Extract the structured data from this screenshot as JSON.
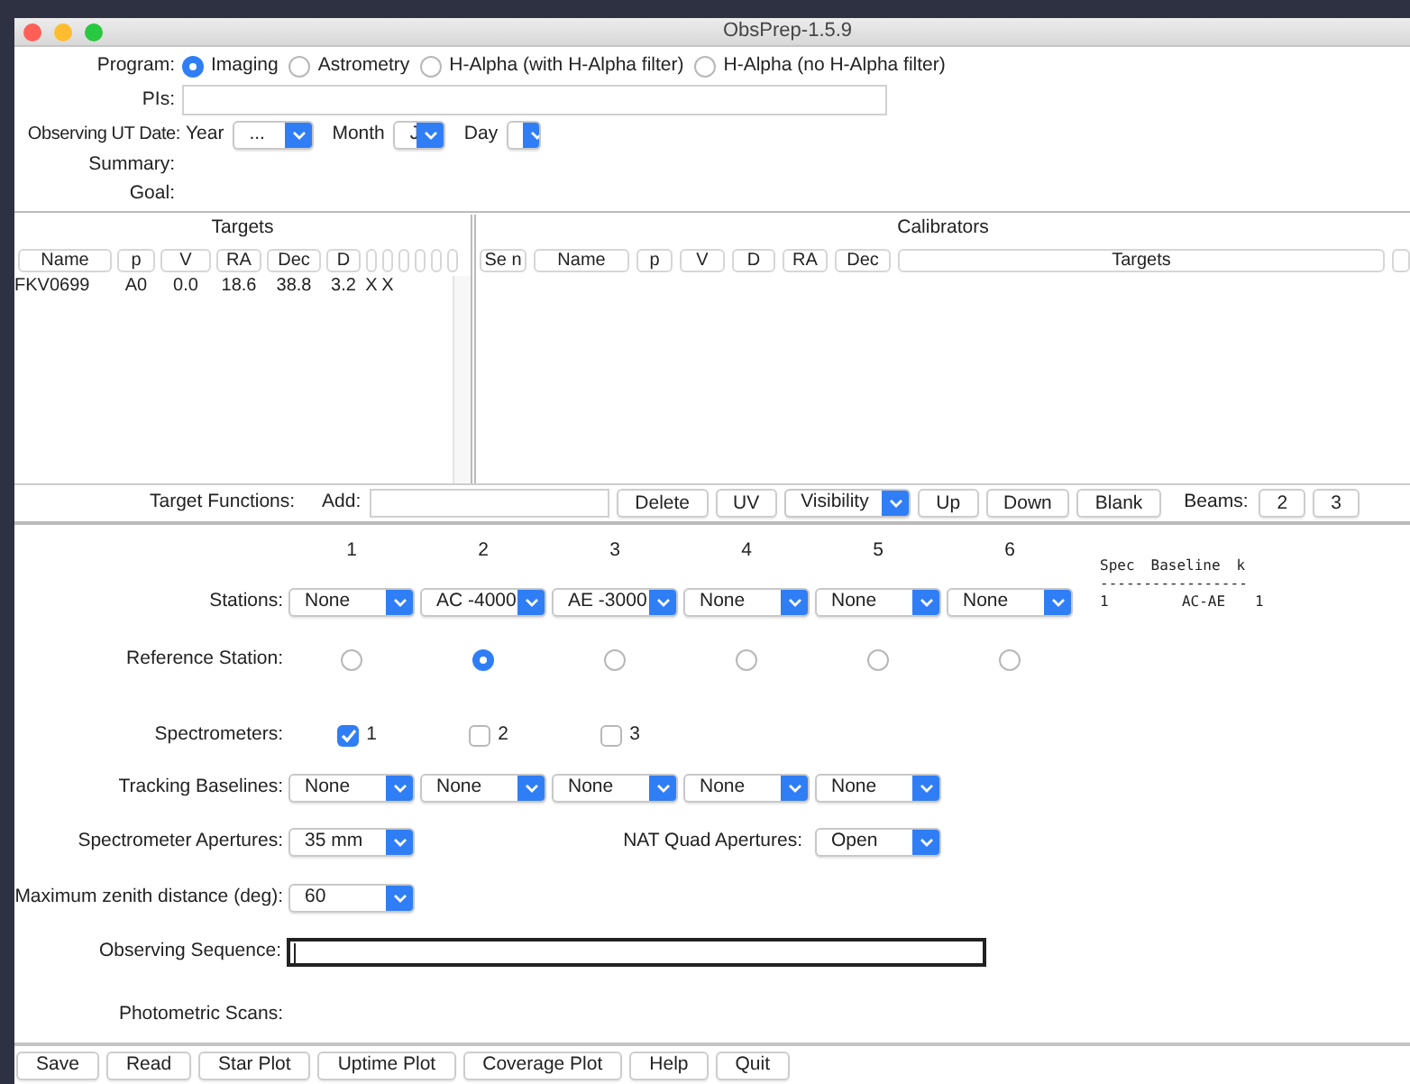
{
  "window": {
    "title": "ObsPrep-1.5.9"
  },
  "program": {
    "label": "Program:",
    "options": [
      {
        "label": "Imaging",
        "selected": true
      },
      {
        "label": "Astrometry",
        "selected": false
      },
      {
        "label": "H-Alpha (with H-Alpha filter)",
        "selected": false
      },
      {
        "label": "H-Alpha (no H-Alpha filter)",
        "selected": false
      }
    ]
  },
  "pis": {
    "label": "PIs:"
  },
  "date": {
    "label": "Observing UT Date:",
    "fields": [
      {
        "label": "Year",
        "value": "..."
      },
      {
        "label": "Month",
        "value": "J"
      },
      {
        "label": "Day"
      }
    ]
  },
  "summary": {
    "label": "Summary:"
  },
  "goal": {
    "label": "Goal:"
  },
  "targets": {
    "title": "Targets",
    "columns": [
      "Name",
      "p",
      "V",
      "RA",
      "Dec",
      "D"
    ],
    "rows": [
      [
        "FKV0699",
        "A0",
        "0.0",
        "18.6",
        "38.8",
        "3.2",
        "X",
        "X"
      ]
    ]
  },
  "calibrators": {
    "title": "Calibrators",
    "columns": [
      "Se n",
      "Name",
      "p",
      "V",
      "D",
      "RA",
      "Dec",
      "Targets"
    ]
  },
  "target_functions": {
    "label": "Target Functions:",
    "add_label": "Add:",
    "buttons_before": [
      "Delete",
      "UV"
    ],
    "view": {
      "value": "Visibility"
    },
    "buttons_after": [
      "Up",
      "Down",
      "Blank"
    ],
    "beams_label": "Beams:",
    "beams": [
      "2",
      "3"
    ]
  },
  "stations": {
    "label": "Stations:",
    "columns": [
      "1",
      "2",
      "3",
      "4",
      "5",
      "6"
    ],
    "values": [
      "None",
      "AC -4000",
      "AE -3000",
      "None",
      "None",
      "None"
    ]
  },
  "baselines_table": {
    "columns": [
      "Spec",
      "Baseline",
      "k"
    ],
    "rule": "-----------------",
    "rows": [
      [
        "1",
        "AC-AE",
        "1"
      ]
    ]
  },
  "reference_station": {
    "label": "Reference Station:",
    "options": [
      {
        "selected": false
      },
      {
        "selected": true
      },
      {
        "selected": false
      },
      {
        "selected": false
      },
      {
        "selected": false
      },
      {
        "selected": false
      }
    ]
  },
  "spectrometers": {
    "label": "Spectrometers:",
    "items": [
      {
        "label": "1",
        "checked": true
      },
      {
        "label": "2",
        "checked": false
      },
      {
        "label": "3",
        "checked": false
      }
    ]
  },
  "tracking_baselines": {
    "label": "Tracking Baselines:",
    "values": [
      "None",
      "None",
      "None",
      "None",
      "None"
    ]
  },
  "spectrometer_apertures": {
    "label": "Spectrometer Apertures:",
    "value": "35 mm"
  },
  "nat_quad_apertures": {
    "label": "NAT Quad Apertures:",
    "value": "Open"
  },
  "max_zenith": {
    "label": "Maximum zenith distance (deg):",
    "value": "60"
  },
  "observing_sequence": {
    "label": "Observing Sequence:",
    "focused": true
  },
  "photometric_scans": {
    "label": "Photometric Scans:"
  },
  "buttons": [
    "Save",
    "Read",
    "Star Plot",
    "Uptime Plot",
    "Coverage Plot",
    "Help",
    "Quit"
  ]
}
